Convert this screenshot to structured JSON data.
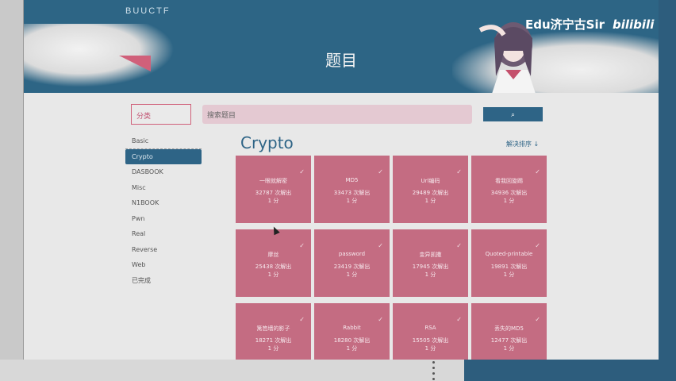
{
  "brand": "BUUCTF",
  "page_title": "题目",
  "watermark": {
    "text": "Edu济宁古Sir",
    "logo": "bilibili"
  },
  "search": {
    "category_placeholder": "分类",
    "input_placeholder": "搜索题目",
    "button_icon": "search-icon"
  },
  "sidebar": {
    "items": [
      {
        "label": "Basic",
        "active": false
      },
      {
        "label": "Crypto",
        "active": true
      },
      {
        "label": "DASBOOK",
        "active": false
      },
      {
        "label": "Misc",
        "active": false
      },
      {
        "label": "N1BOOK",
        "active": false
      },
      {
        "label": "Pwn",
        "active": false
      },
      {
        "label": "Real",
        "active": false
      },
      {
        "label": "Reverse",
        "active": false
      },
      {
        "label": "Web",
        "active": false
      },
      {
        "label": "已完成",
        "active": false
      }
    ]
  },
  "main": {
    "section_title": "Crypto",
    "sort_label": "解决排序 ↓",
    "cards": [
      {
        "name": "一眼就解密",
        "solves": "32787 次解出",
        "score": "1 分"
      },
      {
        "name": "MD5",
        "solves": "33473 次解出",
        "score": "1 分"
      },
      {
        "name": "Url编码",
        "solves": "29489 次解出",
        "score": "1 分"
      },
      {
        "name": "看我回旋踢",
        "solves": "34936 次解出",
        "score": "1 分"
      },
      {
        "name": "摩丝",
        "solves": "25438 次解出",
        "score": "1 分"
      },
      {
        "name": "password",
        "solves": "23419 次解出",
        "score": "1 分"
      },
      {
        "name": "变异凯撒",
        "solves": "17945 次解出",
        "score": "1 分"
      },
      {
        "name": "Quoted-printable",
        "solves": "19891 次解出",
        "score": "1 分"
      },
      {
        "name": "篱笆墙的影子",
        "solves": "18271 次解出",
        "score": "1 分"
      },
      {
        "name": "Rabbit",
        "solves": "18280 次解出",
        "score": "1 分"
      },
      {
        "name": "RSA",
        "solves": "15505 次解出",
        "score": "1 分"
      },
      {
        "name": "丢失的MD5",
        "solves": "12477 次解出",
        "score": "1 分"
      }
    ]
  },
  "colors": {
    "banner": "#2d6585",
    "accent": "#2e6486",
    "card": "#c46c82"
  }
}
